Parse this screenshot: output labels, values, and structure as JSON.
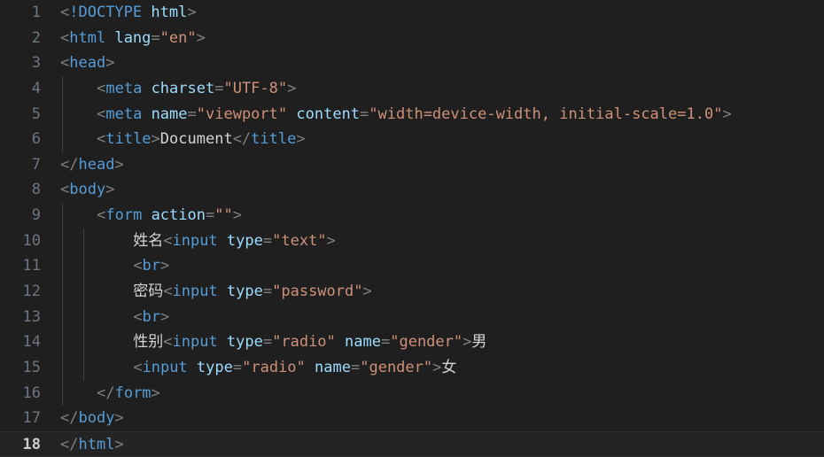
{
  "editor": {
    "language": "html",
    "indent_size": 4,
    "active_line": 18,
    "total_lines": 18,
    "colors": {
      "background": "#1f1f1f",
      "active_line_background": "#242424",
      "gutter_text": "#6e7681",
      "gutter_active_text": "#cccccc",
      "punctuation": "#808080",
      "tag_name": "#569cd6",
      "attribute_name": "#9cdcfe",
      "attribute_value": "#ce9178",
      "plain_text": "#d4d4d4",
      "indent_guide": "#404040"
    }
  },
  "lines": [
    {
      "number": "1",
      "indent": 0,
      "guides": 0,
      "tokens": [
        {
          "t": "pt",
          "v": "<"
        },
        {
          "t": "doct",
          "v": "!DOCTYPE"
        },
        {
          "t": "txt",
          "v": " "
        },
        {
          "t": "doch",
          "v": "html"
        },
        {
          "t": "pt",
          "v": ">"
        }
      ]
    },
    {
      "number": "2",
      "indent": 0,
      "guides": 0,
      "tokens": [
        {
          "t": "pt",
          "v": "<"
        },
        {
          "t": "tag",
          "v": "html"
        },
        {
          "t": "txt",
          "v": " "
        },
        {
          "t": "attr",
          "v": "lang"
        },
        {
          "t": "pt",
          "v": "="
        },
        {
          "t": "str",
          "v": "\"en\""
        },
        {
          "t": "pt",
          "v": ">"
        }
      ]
    },
    {
      "number": "3",
      "indent": 0,
      "guides": 0,
      "tokens": [
        {
          "t": "pt",
          "v": "<"
        },
        {
          "t": "tag",
          "v": "head"
        },
        {
          "t": "pt",
          "v": ">"
        }
      ]
    },
    {
      "number": "4",
      "indent": 4,
      "guides": 1,
      "tokens": [
        {
          "t": "pt",
          "v": "<"
        },
        {
          "t": "tag",
          "v": "meta"
        },
        {
          "t": "txt",
          "v": " "
        },
        {
          "t": "attr",
          "v": "charset"
        },
        {
          "t": "pt",
          "v": "="
        },
        {
          "t": "str",
          "v": "\"UTF-8\""
        },
        {
          "t": "pt",
          "v": ">"
        }
      ]
    },
    {
      "number": "5",
      "indent": 4,
      "guides": 1,
      "tokens": [
        {
          "t": "pt",
          "v": "<"
        },
        {
          "t": "tag",
          "v": "meta"
        },
        {
          "t": "txt",
          "v": " "
        },
        {
          "t": "attr",
          "v": "name"
        },
        {
          "t": "pt",
          "v": "="
        },
        {
          "t": "str",
          "v": "\"viewport\""
        },
        {
          "t": "txt",
          "v": " "
        },
        {
          "t": "attr",
          "v": "content"
        },
        {
          "t": "pt",
          "v": "="
        },
        {
          "t": "str",
          "v": "\"width=device-width, initial-scale=1.0\""
        },
        {
          "t": "pt",
          "v": ">"
        }
      ]
    },
    {
      "number": "6",
      "indent": 4,
      "guides": 1,
      "tokens": [
        {
          "t": "pt",
          "v": "<"
        },
        {
          "t": "tag",
          "v": "title"
        },
        {
          "t": "pt",
          "v": ">"
        },
        {
          "t": "txt",
          "v": "Document"
        },
        {
          "t": "pt",
          "v": "</"
        },
        {
          "t": "tag",
          "v": "title"
        },
        {
          "t": "pt",
          "v": ">"
        }
      ]
    },
    {
      "number": "7",
      "indent": 0,
      "guides": 0,
      "tokens": [
        {
          "t": "pt",
          "v": "</"
        },
        {
          "t": "tag",
          "v": "head"
        },
        {
          "t": "pt",
          "v": ">"
        }
      ]
    },
    {
      "number": "8",
      "indent": 0,
      "guides": 0,
      "tokens": [
        {
          "t": "pt",
          "v": "<"
        },
        {
          "t": "tag",
          "v": "body"
        },
        {
          "t": "pt",
          "v": ">"
        }
      ]
    },
    {
      "number": "9",
      "indent": 4,
      "guides": 1,
      "tokens": [
        {
          "t": "pt",
          "v": "<"
        },
        {
          "t": "tag",
          "v": "form"
        },
        {
          "t": "txt",
          "v": " "
        },
        {
          "t": "attr",
          "v": "action"
        },
        {
          "t": "pt",
          "v": "="
        },
        {
          "t": "str",
          "v": "\"\""
        },
        {
          "t": "pt",
          "v": ">"
        }
      ]
    },
    {
      "number": "10",
      "indent": 8,
      "guides": 2,
      "tokens": [
        {
          "t": "txt",
          "v": "姓名"
        },
        {
          "t": "pt",
          "v": "<"
        },
        {
          "t": "tag",
          "v": "input"
        },
        {
          "t": "txt",
          "v": " "
        },
        {
          "t": "attr",
          "v": "type"
        },
        {
          "t": "pt",
          "v": "="
        },
        {
          "t": "str",
          "v": "\"text\""
        },
        {
          "t": "pt",
          "v": ">"
        }
      ]
    },
    {
      "number": "11",
      "indent": 8,
      "guides": 2,
      "tokens": [
        {
          "t": "pt",
          "v": "<"
        },
        {
          "t": "tag",
          "v": "br"
        },
        {
          "t": "pt",
          "v": ">"
        }
      ]
    },
    {
      "number": "12",
      "indent": 8,
      "guides": 2,
      "tokens": [
        {
          "t": "txt",
          "v": "密码"
        },
        {
          "t": "pt",
          "v": "<"
        },
        {
          "t": "tag",
          "v": "input"
        },
        {
          "t": "txt",
          "v": " "
        },
        {
          "t": "attr",
          "v": "type"
        },
        {
          "t": "pt",
          "v": "="
        },
        {
          "t": "str",
          "v": "\"password\""
        },
        {
          "t": "pt",
          "v": ">"
        }
      ]
    },
    {
      "number": "13",
      "indent": 8,
      "guides": 2,
      "tokens": [
        {
          "t": "pt",
          "v": "<"
        },
        {
          "t": "tag",
          "v": "br"
        },
        {
          "t": "pt",
          "v": ">"
        }
      ]
    },
    {
      "number": "14",
      "indent": 8,
      "guides": 2,
      "tokens": [
        {
          "t": "txt",
          "v": "性别"
        },
        {
          "t": "pt",
          "v": "<"
        },
        {
          "t": "tag",
          "v": "input"
        },
        {
          "t": "txt",
          "v": " "
        },
        {
          "t": "attr",
          "v": "type"
        },
        {
          "t": "pt",
          "v": "="
        },
        {
          "t": "str",
          "v": "\"radio\""
        },
        {
          "t": "txt",
          "v": " "
        },
        {
          "t": "attr",
          "v": "name"
        },
        {
          "t": "pt",
          "v": "="
        },
        {
          "t": "str",
          "v": "\"gender\""
        },
        {
          "t": "pt",
          "v": ">"
        },
        {
          "t": "txt",
          "v": "男"
        }
      ]
    },
    {
      "number": "15",
      "indent": 8,
      "guides": 2,
      "tokens": [
        {
          "t": "pt",
          "v": "<"
        },
        {
          "t": "tag",
          "v": "input"
        },
        {
          "t": "txt",
          "v": " "
        },
        {
          "t": "attr",
          "v": "type"
        },
        {
          "t": "pt",
          "v": "="
        },
        {
          "t": "str",
          "v": "\"radio\""
        },
        {
          "t": "txt",
          "v": " "
        },
        {
          "t": "attr",
          "v": "name"
        },
        {
          "t": "pt",
          "v": "="
        },
        {
          "t": "str",
          "v": "\"gender\""
        },
        {
          "t": "pt",
          "v": ">"
        },
        {
          "t": "txt",
          "v": "女"
        }
      ]
    },
    {
      "number": "16",
      "indent": 4,
      "guides": 1,
      "tokens": [
        {
          "t": "pt",
          "v": "</"
        },
        {
          "t": "tag",
          "v": "form"
        },
        {
          "t": "pt",
          "v": ">"
        }
      ]
    },
    {
      "number": "17",
      "indent": 0,
      "guides": 0,
      "tokens": [
        {
          "t": "pt",
          "v": "</"
        },
        {
          "t": "tag",
          "v": "body"
        },
        {
          "t": "pt",
          "v": ">"
        }
      ]
    },
    {
      "number": "18",
      "indent": 0,
      "guides": 0,
      "active": true,
      "tokens": [
        {
          "t": "pt",
          "v": "</"
        },
        {
          "t": "tag",
          "v": "html"
        },
        {
          "t": "pt",
          "v": ">"
        }
      ]
    }
  ]
}
